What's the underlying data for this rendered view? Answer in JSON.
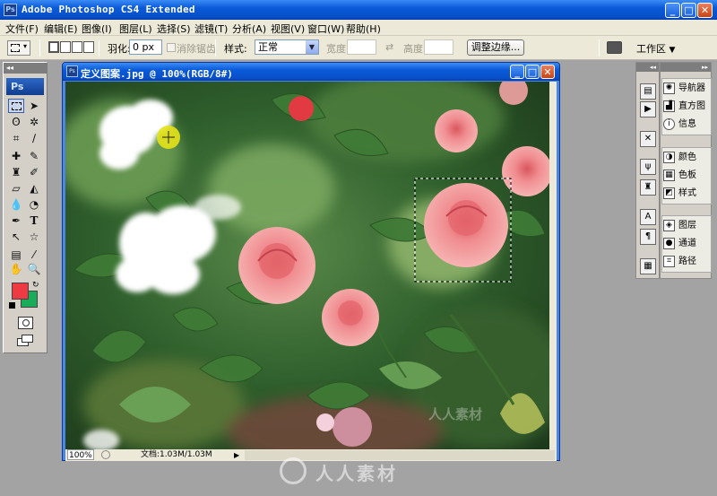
{
  "app": {
    "title": "Adobe Photoshop CS4 Extended",
    "icon": "Ps"
  },
  "menu": [
    "文件(F)",
    "编辑(E)",
    "图像(I)",
    "图层(L)",
    "选择(S)",
    "滤镜(T)",
    "分析(A)",
    "视图(V)",
    "窗口(W)",
    "帮助(H)"
  ],
  "options": {
    "feather_label": "羽化:",
    "feather_value": "0 px",
    "antialias_label": "消除锯齿",
    "style_label": "样式:",
    "style_value": "正常",
    "width_label": "宽度:",
    "height_label": "高度:",
    "refine_edge": "调整边缘...",
    "workspace": "工作区"
  },
  "toolbox": {
    "badge": "Ps"
  },
  "document": {
    "title": "定义图案.jpg @ 100%(RGB/8#)",
    "zoom": "100%",
    "doc_info": "文档:1.03M/1.03M"
  },
  "panels": {
    "group1": [
      "导航器",
      "直方图",
      "信息"
    ],
    "group2": [
      "颜色",
      "色板",
      "样式"
    ],
    "group3": [
      "图层",
      "通道",
      "路径"
    ]
  },
  "colors": {
    "foreground": "#ee3a43",
    "background": "#1aac5a",
    "title_blue": "#0a5ad8"
  },
  "watermark": "人人素材"
}
